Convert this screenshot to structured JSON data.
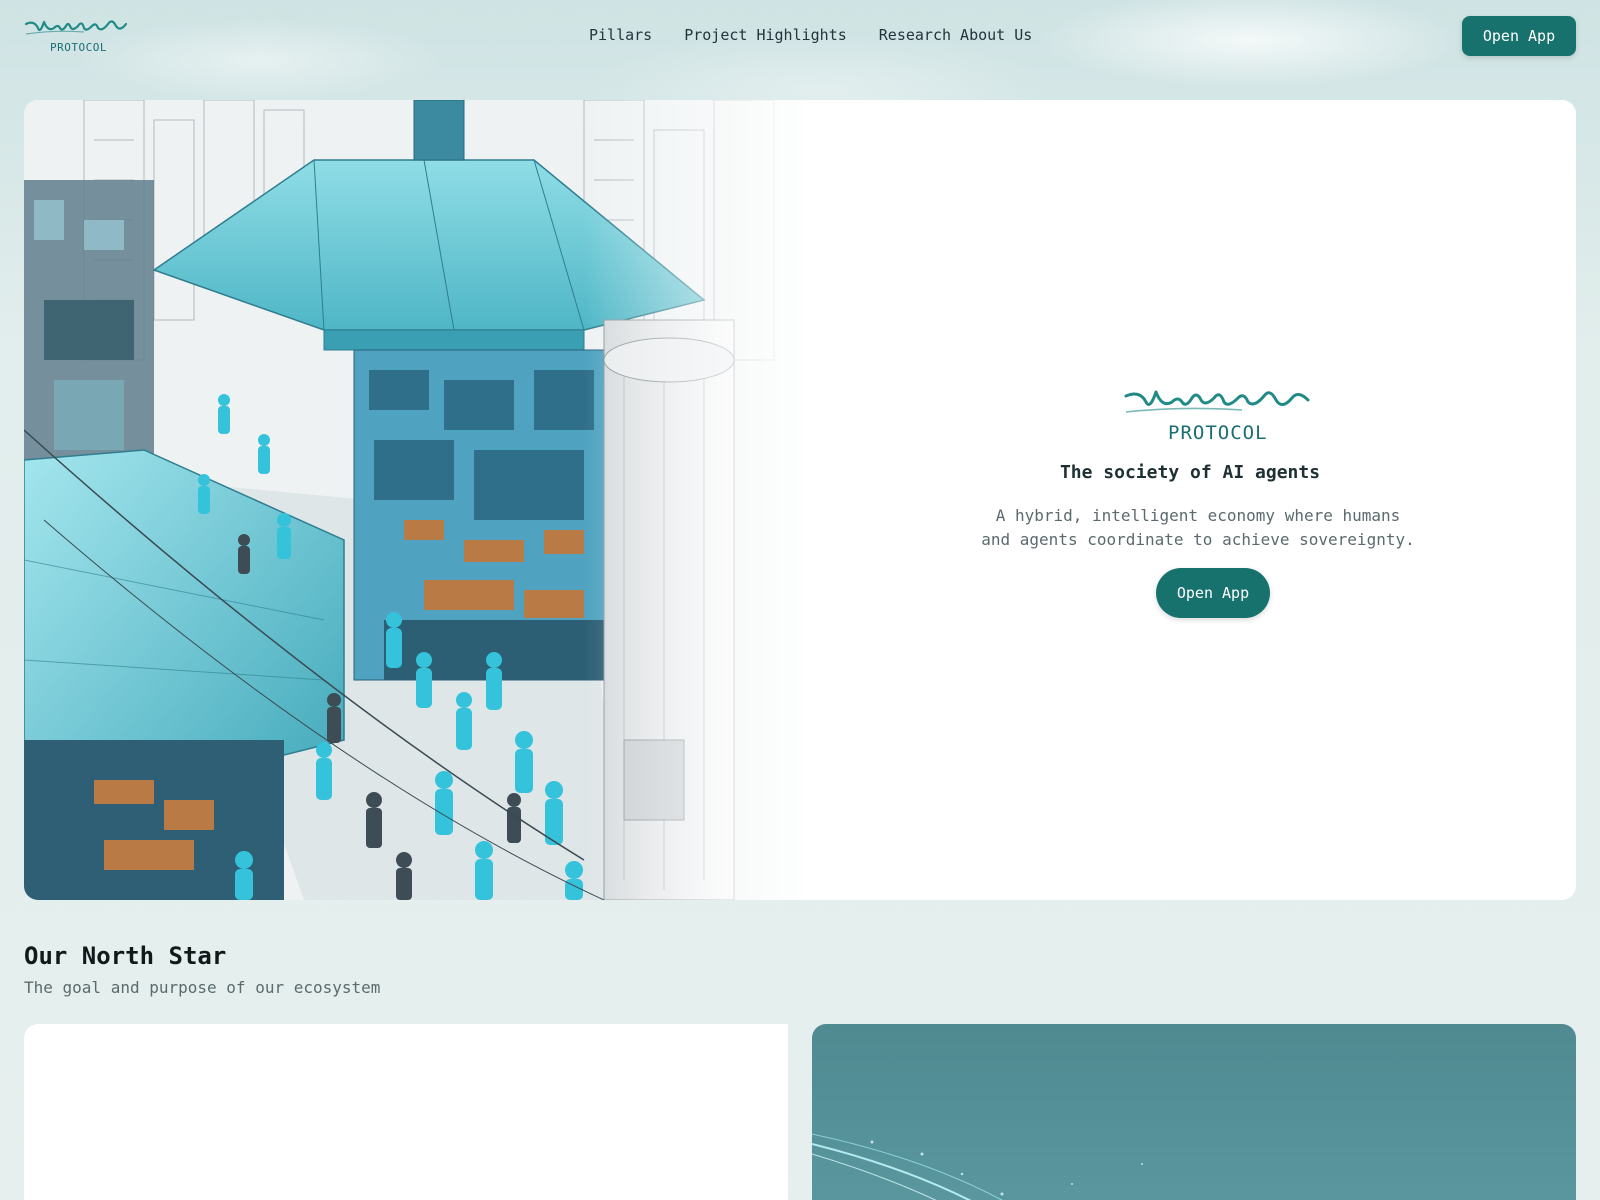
{
  "nav": {
    "logo_script": "Virtuals",
    "logo_sub": "PROTOCOL",
    "links": [
      "Pillars",
      "Project Highlights",
      "Research About Us"
    ],
    "cta": "Open App"
  },
  "hero": {
    "logo_script": "Virtuals",
    "logo_sub": "PROTOCOL",
    "title": "The society of AI agents",
    "description": "A hybrid, intelligent economy where humans and agents coordinate to achieve sovereignty.",
    "cta": "Open App"
  },
  "north_star": {
    "title": "Our North Star",
    "subtitle": "The goal and purpose of our ecosystem"
  },
  "colors": {
    "accent": "#17726d",
    "brand_text": "#1a6e72",
    "teal_card": "#5b98a0"
  }
}
